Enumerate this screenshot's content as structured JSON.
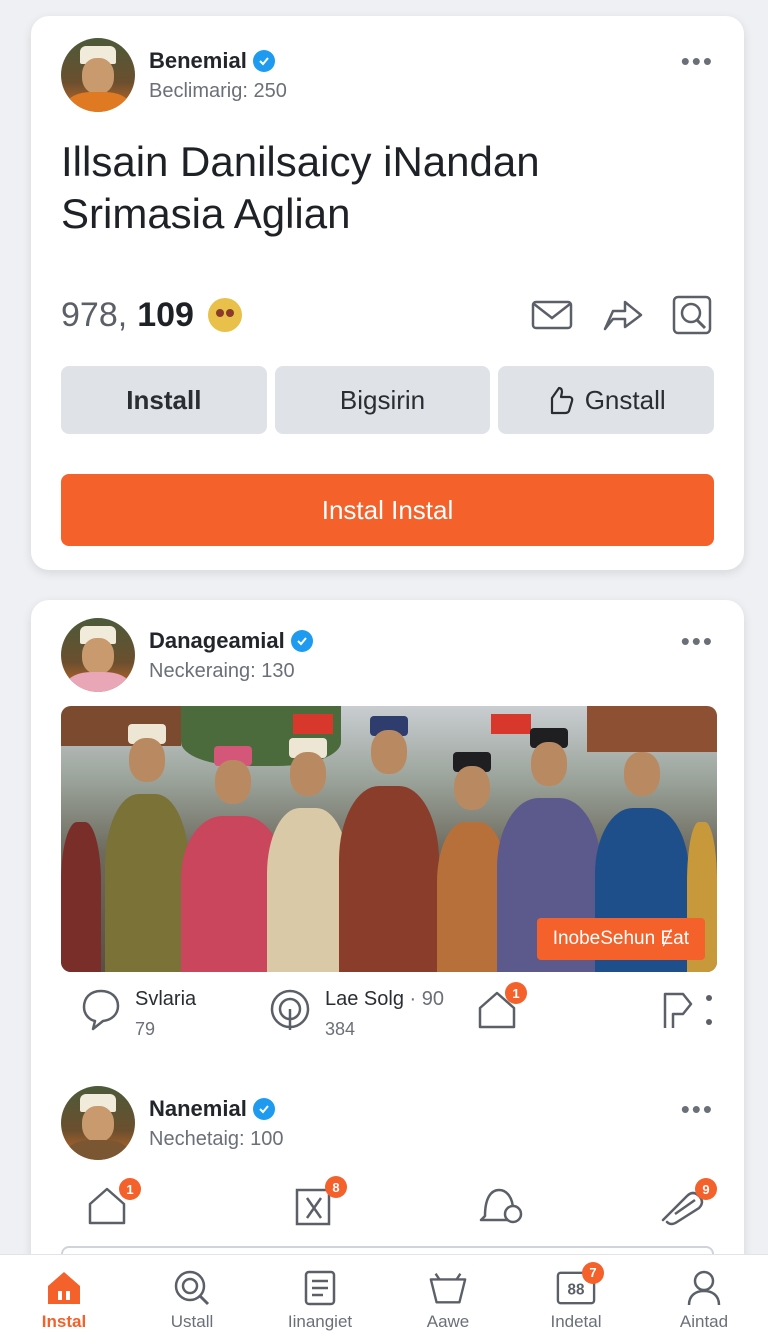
{
  "post1": {
    "author": "Benemial",
    "subtitle": "Beclimarig: 250",
    "title": "Illsain Danilsaicy iNandan Srimasia Aglian",
    "count_a": "978,",
    "count_b": "109",
    "icons": [
      "mail-icon",
      "share-arrow-icon",
      "search-square-icon"
    ],
    "buttons": [
      "Install",
      "Bigsirin",
      "Gnstall"
    ],
    "primary_button": "Instal Instal"
  },
  "post2": {
    "author": "Danageamial",
    "subtitle": "Neckeraing: 130",
    "photo_badge": "InobeSehun Ɇat",
    "reactions": [
      {
        "label": "Svlaria",
        "count": "79"
      },
      {
        "label": "Lae  Solg",
        "extra": "· 90",
        "count": "384"
      },
      {
        "badge": "1"
      }
    ]
  },
  "post3": {
    "author": "Nanemial",
    "subtitle": "Nechetaig: 100",
    "badges": [
      "1",
      "8",
      "",
      "9"
    ]
  },
  "tabbar": {
    "tabs": [
      {
        "label": "Instal",
        "icon": "home-icon",
        "active": true
      },
      {
        "label": "Ustall",
        "icon": "search-icon"
      },
      {
        "label": "Iinangiet",
        "icon": "document-icon"
      },
      {
        "label": "Aawe",
        "icon": "bag-icon"
      },
      {
        "label": "Indetal",
        "icon": "grid-88-icon",
        "badge": "7"
      },
      {
        "label": "Aintad",
        "icon": "profile-icon"
      }
    ]
  },
  "colors": {
    "accent": "#f4612b",
    "verified": "#1e9bf0",
    "button_gray": "#dfe3e8"
  }
}
